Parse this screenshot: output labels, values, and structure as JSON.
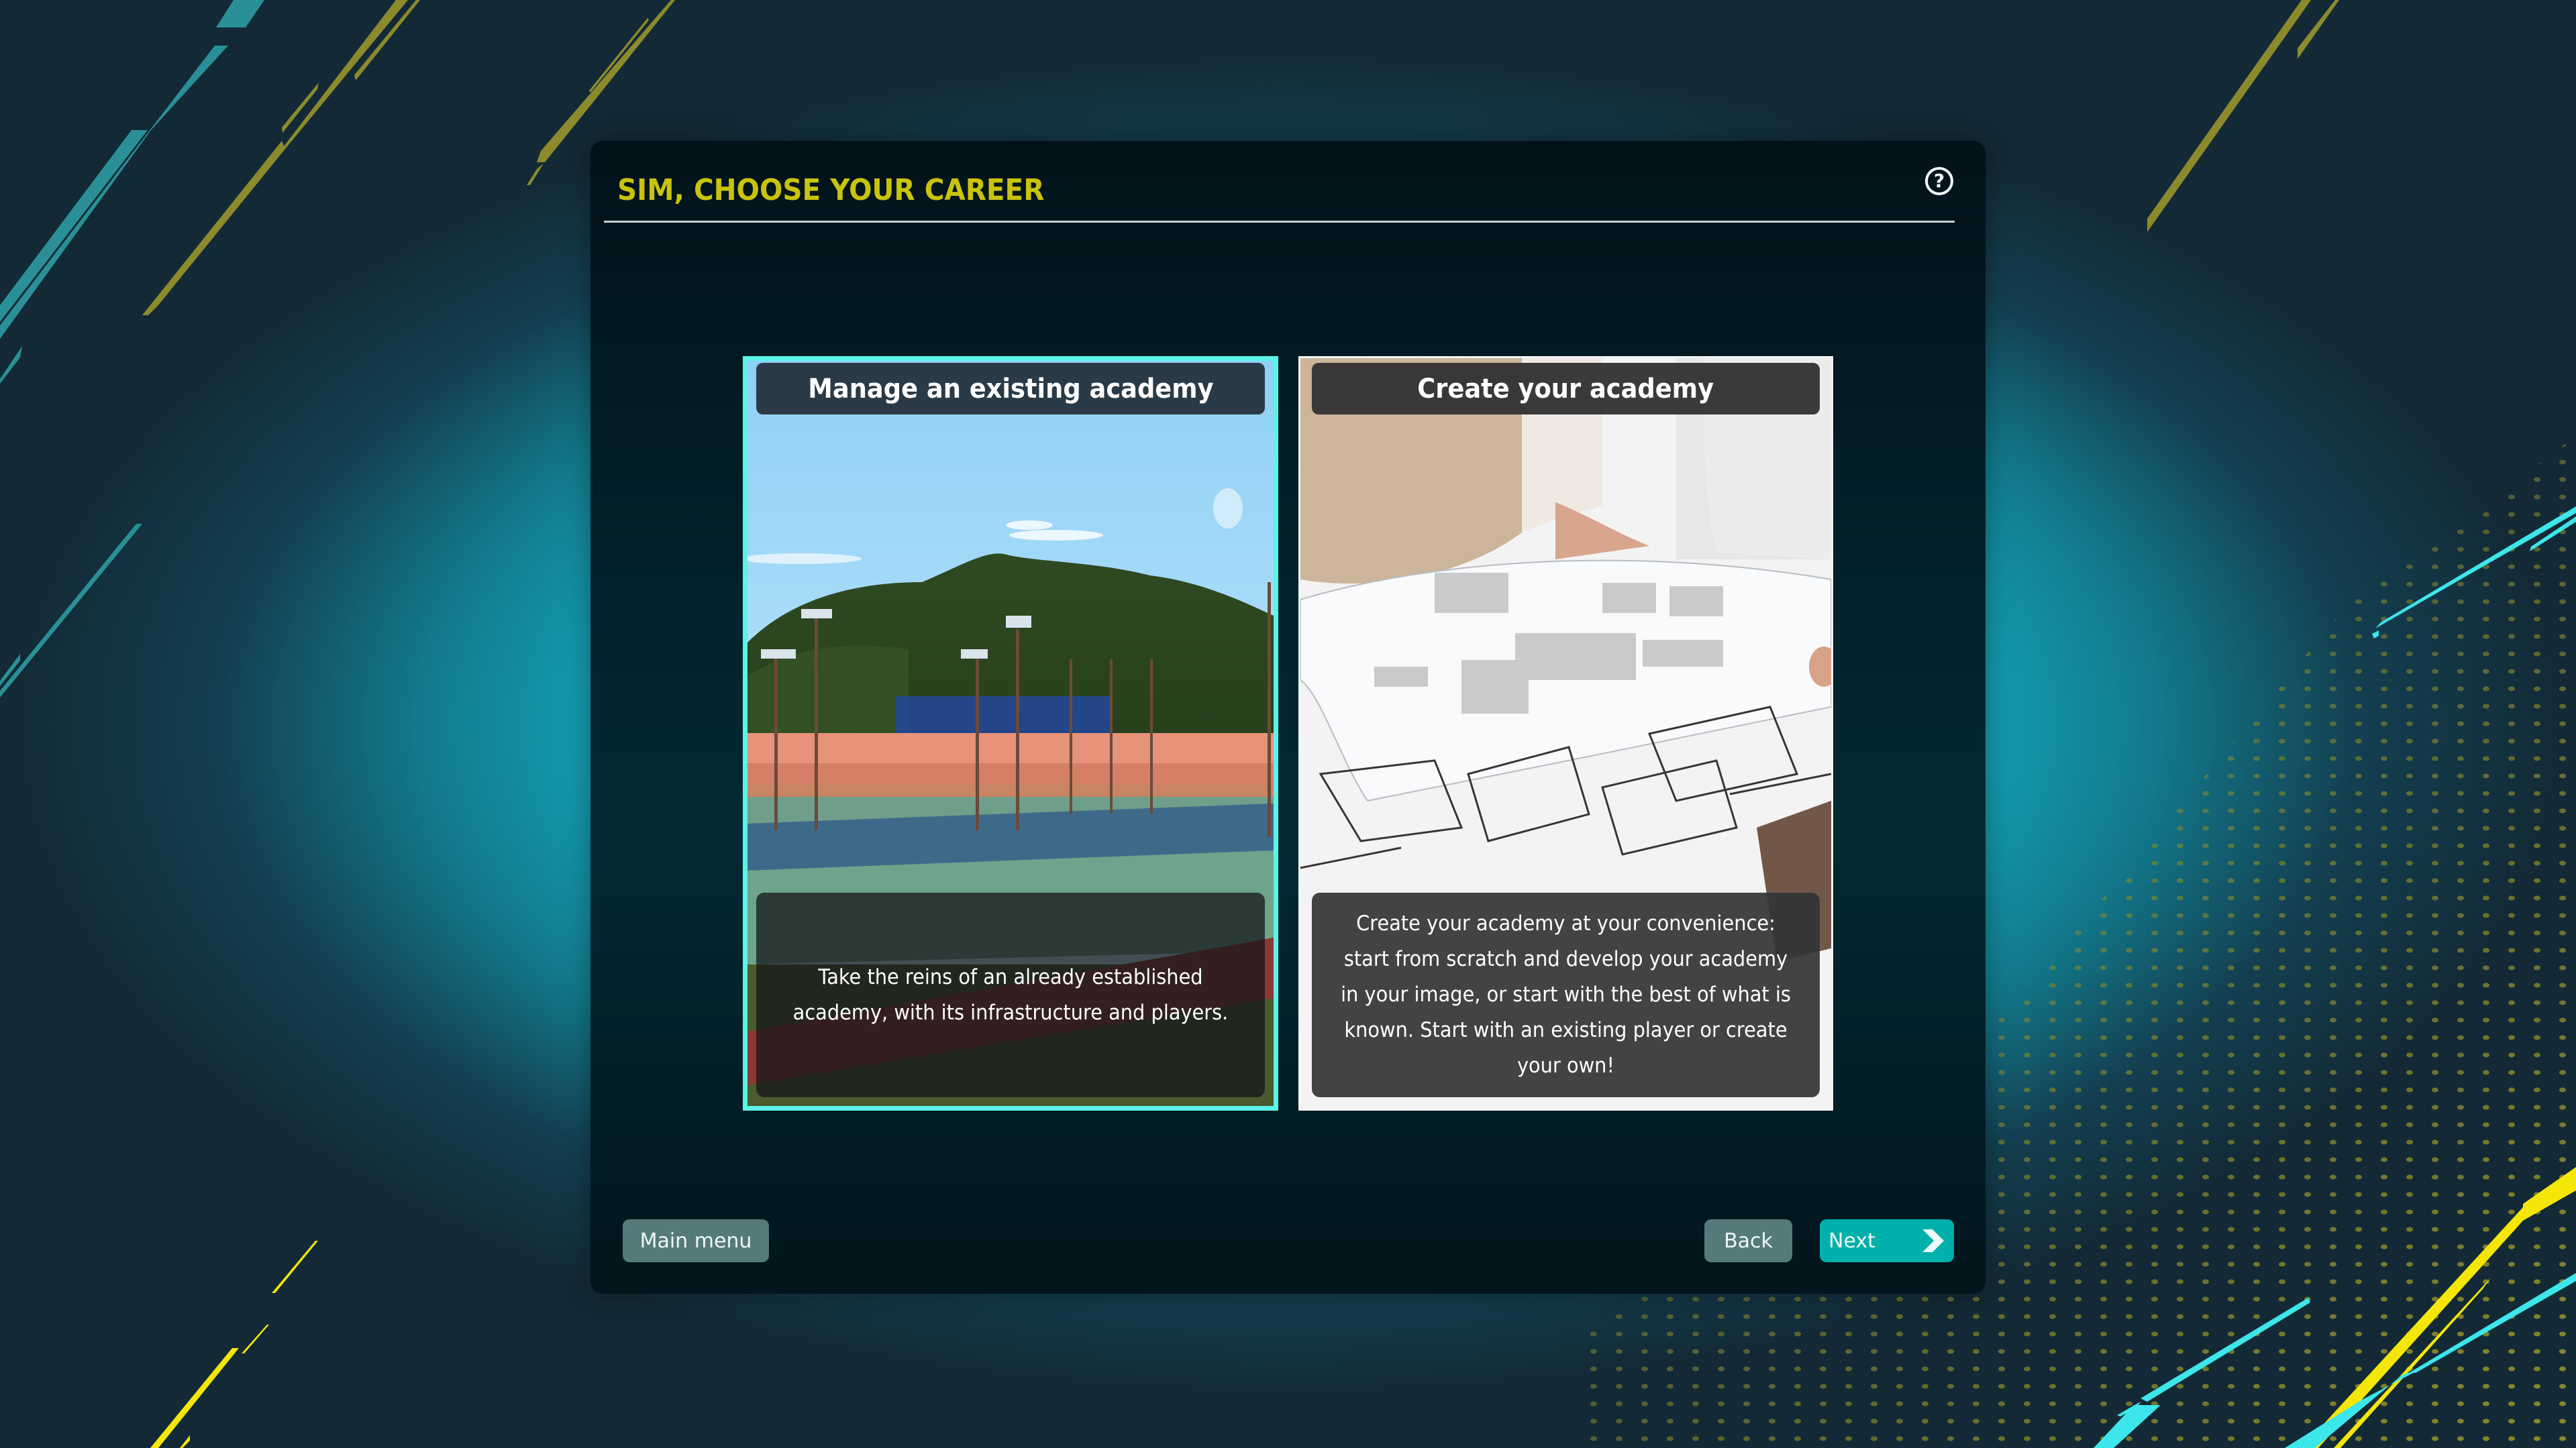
{
  "header": {
    "title": "SIM, CHOOSE YOUR CAREER",
    "help_icon": "question-circle-icon"
  },
  "cards": [
    {
      "title": "Manage an existing academy",
      "description": "Take the reins of an already established academy, with its infrastructure and players.",
      "image": "tennis-academy-courts-photo",
      "selected": true
    },
    {
      "title": "Create your academy",
      "description": "Create your academy at your convenience: start from scratch and develop your academy in your image, or start with the best of what is known. Start with an existing player or create your own!",
      "image": "architectural-blueprints-photo",
      "selected": false
    }
  ],
  "footer": {
    "main_menu_label": "Main menu",
    "back_label": "Back",
    "next_label": "Next",
    "next_icon": "chevron-right-icon"
  },
  "colors": {
    "title": "#c9c30b",
    "selected_border": "#5cf3e8",
    "next_button": "#00b0aa",
    "secondary_button": "#557a7b",
    "background_glow": "#15b8ce",
    "accent_yellow": "#f5e60a"
  }
}
